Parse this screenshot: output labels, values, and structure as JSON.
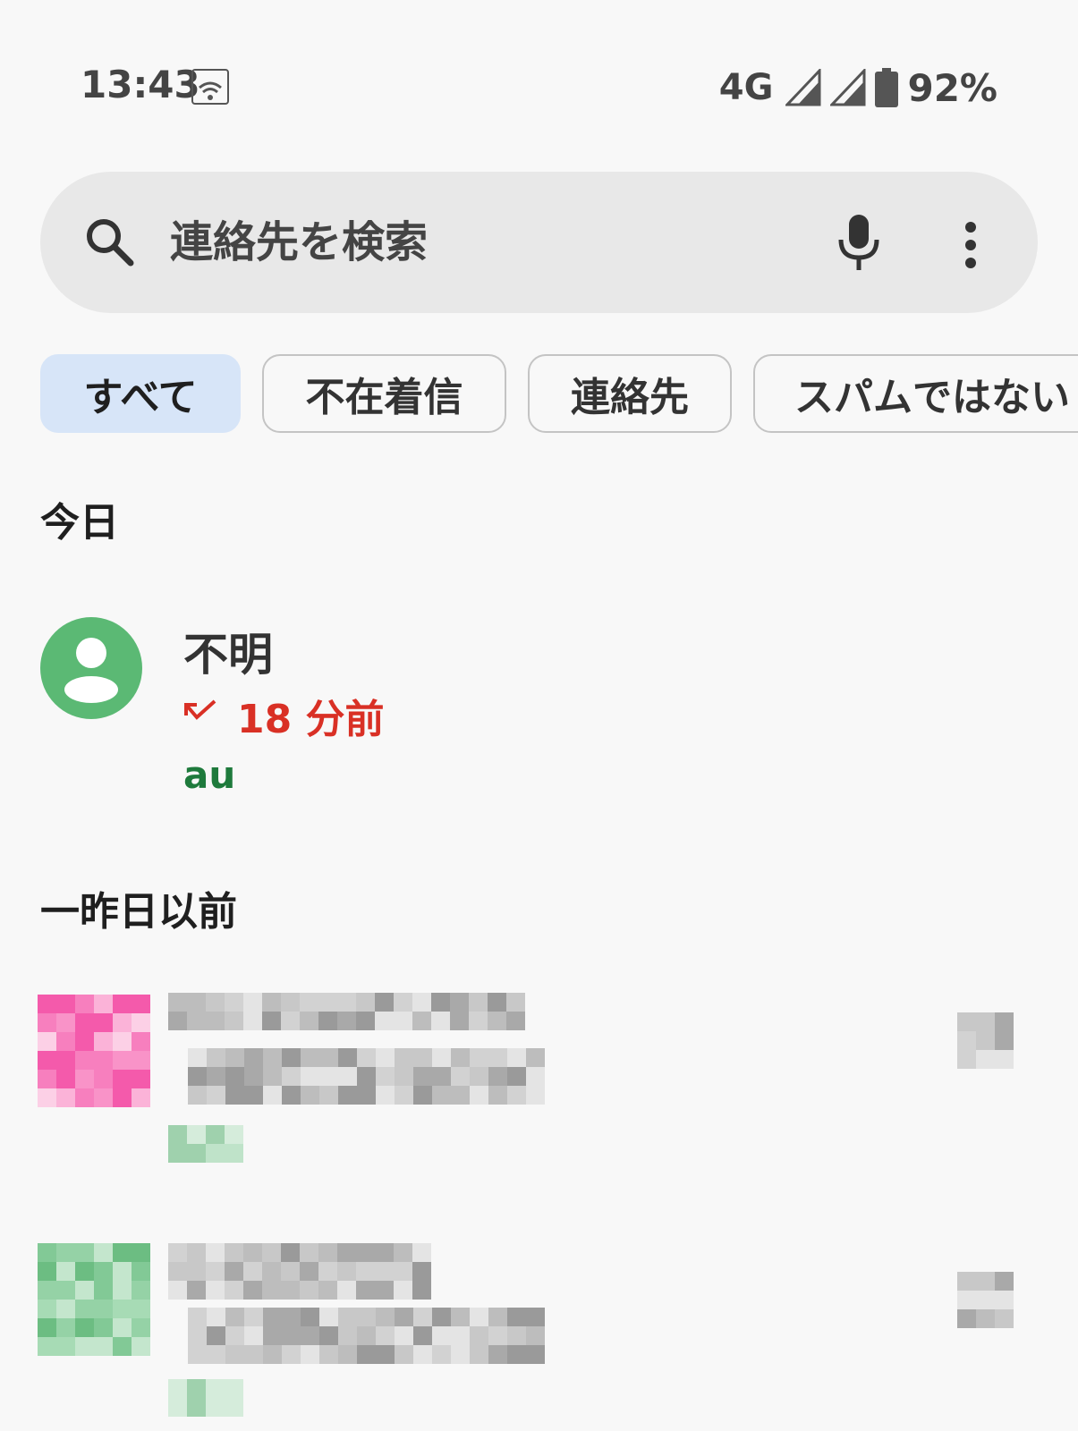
{
  "status_bar": {
    "time": "13:43",
    "network": "4G",
    "battery": "92%"
  },
  "search": {
    "placeholder": "連絡先を検索"
  },
  "filters": [
    {
      "label": "すべて",
      "selected": true
    },
    {
      "label": "不在着信",
      "selected": false
    },
    {
      "label": "連絡先",
      "selected": false
    },
    {
      "label": "スパムではない",
      "selected": false
    }
  ],
  "sections": {
    "today": "今日",
    "older": "一昨日以前"
  },
  "calls": [
    {
      "name": "不明",
      "time": "18 分前",
      "carrier": "au",
      "avatar_color": "#5bb974",
      "status_color": "#d93025"
    }
  ],
  "colors": {
    "accent_chip": "#d7e5f8",
    "missed": "#d93025",
    "carrier": "#1e7a3c"
  }
}
